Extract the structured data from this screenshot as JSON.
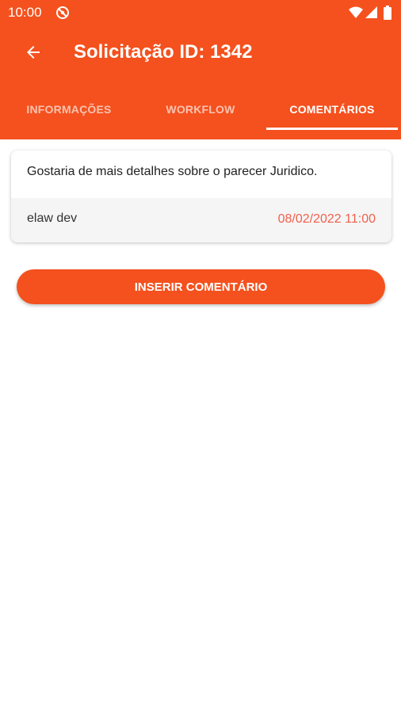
{
  "status_bar": {
    "time": "10:00",
    "icons": [
      "do-not-disturb-icon",
      "wifi-icon",
      "signal-icon",
      "battery-icon"
    ]
  },
  "toolbar": {
    "back_icon": "arrow-left-icon",
    "title": "Solicitação ID: 1342"
  },
  "tabs": [
    {
      "label": "INFORMAÇÕES",
      "active": false
    },
    {
      "label": "WORKFLOW",
      "active": false
    },
    {
      "label": "COMENTÁRIOS",
      "active": true
    }
  ],
  "comments": [
    {
      "text": "Gostaria de mais detalhes sobre o parecer Juridico.",
      "author": "elaw dev",
      "date": "08/02/2022 11:00"
    }
  ],
  "actions": {
    "insert_comment_label": "INSERIR COMENTÁRIO"
  },
  "colors": {
    "primary": "#f4511e",
    "date_accent": "#f0604d",
    "card_footer_bg": "#f5f5f5"
  }
}
